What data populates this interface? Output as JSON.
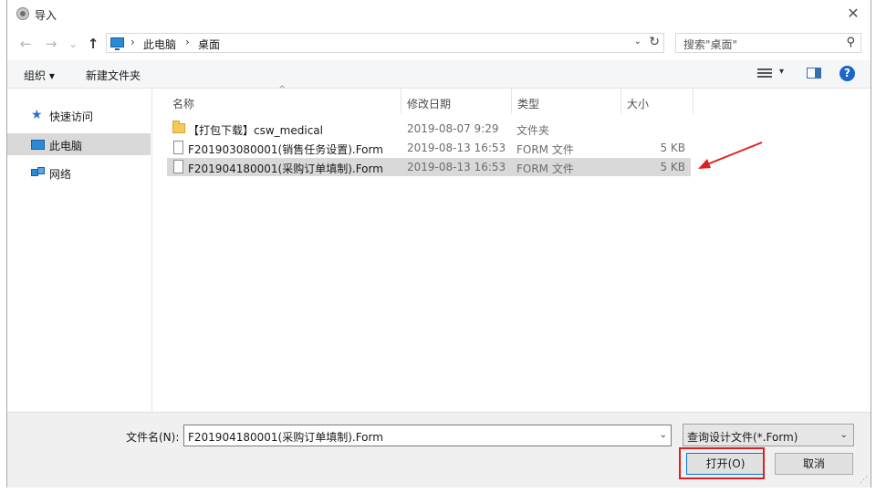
{
  "window": {
    "title": "导入",
    "close_glyph": "✕"
  },
  "nav_buttons": {
    "back_glyph": "←",
    "forward_glyph": "→",
    "history_glyph": "⌄",
    "up_glyph": "↑"
  },
  "address": {
    "crumbs": [
      "此电脑",
      "桌面"
    ],
    "separator": "›",
    "drop_glyph": "⌄",
    "refresh_glyph": "↻"
  },
  "search": {
    "placeholder": "搜索\"桌面\"",
    "icon_glyph": "⚲"
  },
  "toolbar": {
    "organize_label": "组织 ▾",
    "new_folder_label": "新建文件夹",
    "view_drop_glyph": "▾",
    "help_glyph": "?"
  },
  "nav_pane": {
    "items": [
      {
        "label": "快速访问",
        "icon": "star-icon",
        "icon_glyph": "★"
      },
      {
        "label": "此电脑",
        "icon": "computer-icon",
        "selected": true
      },
      {
        "label": "网络",
        "icon": "network-icon"
      }
    ]
  },
  "columns": {
    "name": "名称",
    "date": "修改日期",
    "type": "类型",
    "size": "大小",
    "sort_glyph": "^"
  },
  "files": [
    {
      "name": "【打包下载】csw_medical",
      "date": "2019-08-07 9:29",
      "type": "文件夹",
      "size": "",
      "kind": "folder"
    },
    {
      "name": "F201903080001(销售任务设置).Form",
      "date": "2019-08-13 16:53",
      "type": "FORM 文件",
      "size": "5 KB",
      "kind": "file"
    },
    {
      "name": "F201904180001(采购订单填制).Form",
      "date": "2019-08-13 16:53",
      "type": "FORM 文件",
      "size": "5 KB",
      "kind": "file",
      "selected": true
    }
  ],
  "footer": {
    "filename_label": "文件名(N):",
    "filename_value": "F201904180001(采购订单填制).Form",
    "filetype_value": "查询设计文件(*.Form)",
    "open_label": "打开(O)",
    "cancel_label": "取消",
    "drop_glyph": "⌄",
    "grip_glyph": "⋰"
  },
  "colors": {
    "annotation_red": "#e02020",
    "selection_gray": "#d9d9d9",
    "accent_blue": "#0078d7"
  }
}
